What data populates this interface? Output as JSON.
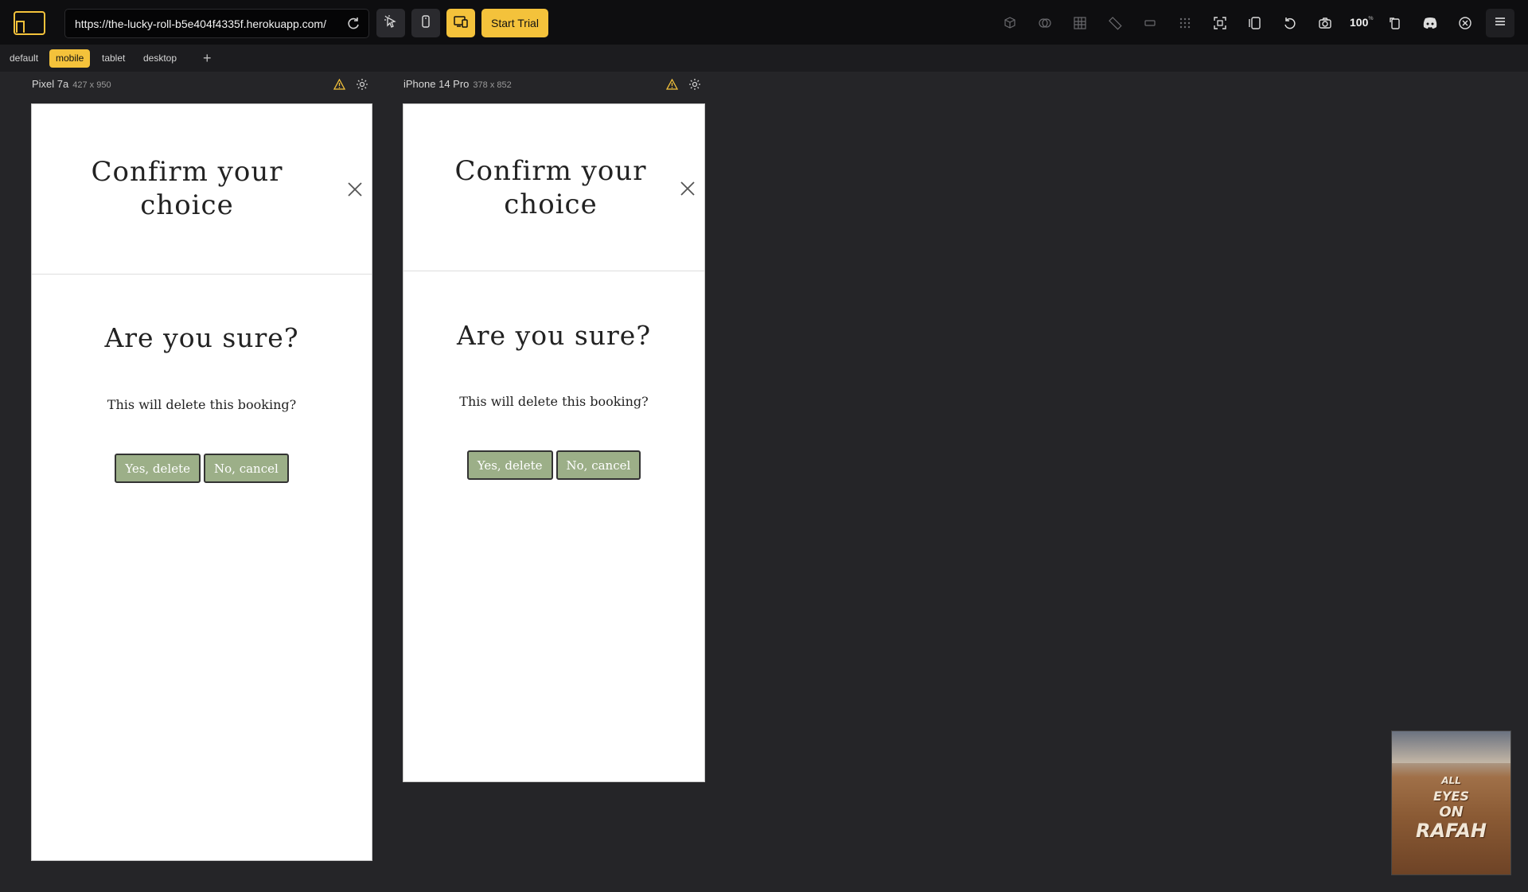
{
  "toolbar": {
    "url": "https://the-lucky-roll-b5e404f4335f.herokuapp.com/",
    "start_trial_label": "Start Trial",
    "zoom_value": "100",
    "zoom_unit": "%",
    "accent_color": "#f4c23b",
    "icons_left": [
      "layout-logo-icon",
      "reload-icon",
      "inspect-cursor-icon",
      "mobile-device-icon",
      "responsive-devices-icon"
    ],
    "icons_right": [
      "cube-icon",
      "overlap-circles-icon",
      "grid-icon",
      "ruler-icon",
      "rectangle-icon",
      "dots-grid-icon",
      "screenshot-frame-icon",
      "sidebar-toggle-icon",
      "rotate-icon",
      "camera-icon",
      "device-rotate-icon",
      "discord-icon",
      "close-circle-icon",
      "menu-icon"
    ]
  },
  "tabs": {
    "items": [
      "default",
      "mobile",
      "tablet",
      "desktop"
    ],
    "active": "mobile",
    "add_label": "+"
  },
  "devices": [
    {
      "name": "Pixel 7a",
      "size": "427 x 950",
      "modal_title": "Confirm your choice",
      "heading": "Are you sure?",
      "message": "This will delete this booking?",
      "confirm_label": "Yes, delete",
      "cancel_label": "No, cancel"
    },
    {
      "name": "iPhone 14 Pro",
      "size": "378 x 852",
      "modal_title": "Confirm your choice",
      "heading": "Are you sure?",
      "message": "This will delete this booking?",
      "confirm_label": "Yes, delete",
      "cancel_label": "No, cancel"
    }
  ],
  "thumbnail": {
    "lines": [
      "ALL",
      "EYES",
      "ON",
      "RAFAH"
    ]
  },
  "colors": {
    "button_fill": "#9caf88",
    "background": "#252528"
  }
}
